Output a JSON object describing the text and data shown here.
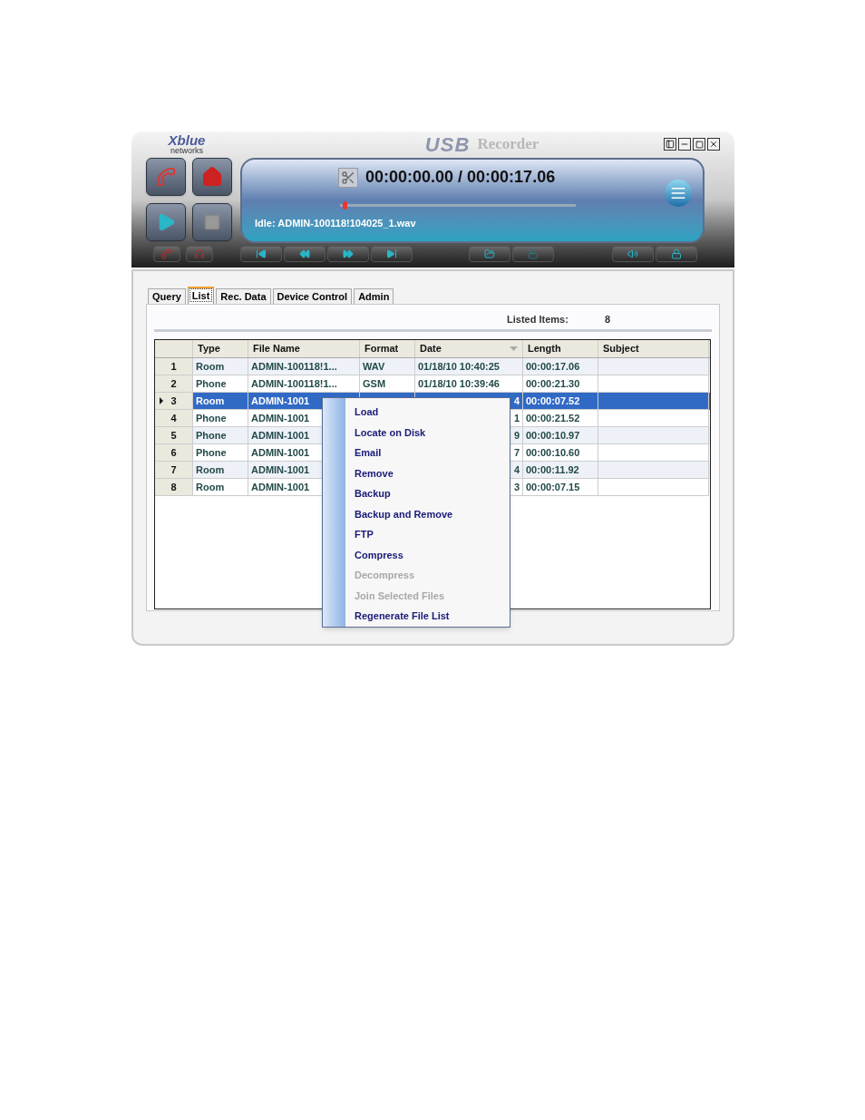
{
  "header": {
    "logo": "Xblue",
    "logo_sub": "networks",
    "title_mark": "USB",
    "title": "Recorder"
  },
  "player": {
    "time": "00:00:00.00 / 00:00:17.06",
    "level": 0.02,
    "status": "Idle: ADMIN-100118!104025_1.wav"
  },
  "tabs": [
    {
      "label": "Query",
      "selected": false
    },
    {
      "label": "List",
      "selected": true
    },
    {
      "label": "Rec. Data",
      "selected": false
    },
    {
      "label": "Device Control",
      "selected": false
    },
    {
      "label": "Admin",
      "selected": false
    }
  ],
  "summary": {
    "label": "Listed Items:",
    "value": "8"
  },
  "table": {
    "columns": [
      "Type",
      "File Name",
      "Format",
      "Date",
      "Length",
      "Subject"
    ],
    "rows": [
      {
        "row_header": "1",
        "type": "Room",
        "file_name": "ADMIN-100118!1...",
        "format": "WAV",
        "date": "01/18/10 10:40:25",
        "length": "00:00:17.06",
        "selected": false
      },
      {
        "row_header": "2",
        "type": "Phone",
        "file_name": "ADMIN-100118!1...",
        "format": "GSM",
        "date": "01/18/10 10:39:46",
        "length": "00:00:21.30",
        "selected": false
      },
      {
        "row_header": "3",
        "type": "Room",
        "file_name": "ADMIN-1001",
        "date": "4",
        "length": "00:00:07.52",
        "selected": true
      },
      {
        "row_header": "4",
        "type": "Phone",
        "file_name": "ADMIN-1001",
        "date": "1",
        "length": "00:00:21.52",
        "selected": false
      },
      {
        "row_header": "5",
        "type": "Phone",
        "file_name": "ADMIN-1001",
        "date": "9",
        "length": "00:00:10.97",
        "selected": false
      },
      {
        "row_header": "6",
        "type": "Phone",
        "file_name": "ADMIN-1001",
        "date": "7",
        "length": "00:00:10.60",
        "selected": false
      },
      {
        "row_header": "7",
        "type": "Room",
        "file_name": "ADMIN-1001",
        "date": "4",
        "length": "00:00:11.92",
        "selected": false
      },
      {
        "row_header": "8",
        "type": "Room",
        "file_name": "ADMIN-1001",
        "date": "3",
        "length": "00:00:07.15",
        "selected": false
      }
    ]
  },
  "context_menu": [
    {
      "label": "Load",
      "disabled": false
    },
    {
      "label": "Locate on Disk",
      "disabled": false
    },
    {
      "label": "Email",
      "disabled": false
    },
    {
      "label": "Remove",
      "disabled": false
    },
    {
      "label": "Backup",
      "disabled": false
    },
    {
      "label": "Backup and Remove",
      "disabled": false
    },
    {
      "label": "FTP",
      "disabled": false
    },
    {
      "label": "Compress",
      "disabled": false
    },
    {
      "label": "Decompress",
      "disabled": true
    },
    {
      "label": "Join Selected Files",
      "disabled": true
    },
    {
      "label": "Regenerate File List",
      "disabled": false
    }
  ]
}
